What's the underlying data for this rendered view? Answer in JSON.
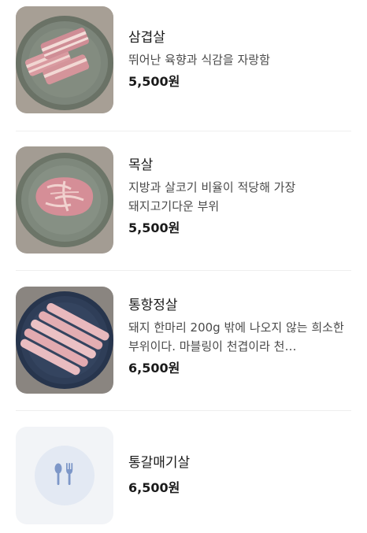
{
  "menu": {
    "items": [
      {
        "name": "삼겹살",
        "description": "뛰어난 육향과 식감을 자랑함",
        "price": "5,500원",
        "image": "samgyeopsal-photo"
      },
      {
        "name": "목살",
        "description": "지방과 살코기 비율이 적당해 가장 돼지고기다운 부위",
        "price": "5,500원",
        "image": "moksal-photo"
      },
      {
        "name": "통항정살",
        "description": "돼지 한마리 200g 밖에 나오지 않는 희소한 부위이다. 마블링이 천겹이라 천…",
        "price": "6,500원",
        "image": "hangjeongsal-photo"
      },
      {
        "name": "통갈매기살",
        "description": "",
        "price": "6,500원",
        "image": "utensils-icon"
      }
    ]
  },
  "colors": {
    "placeholder_bg": "#f2f4f7",
    "placeholder_circle": "#e3e9f3",
    "icon_blue": "#7d97c8",
    "divider": "#efefef"
  }
}
